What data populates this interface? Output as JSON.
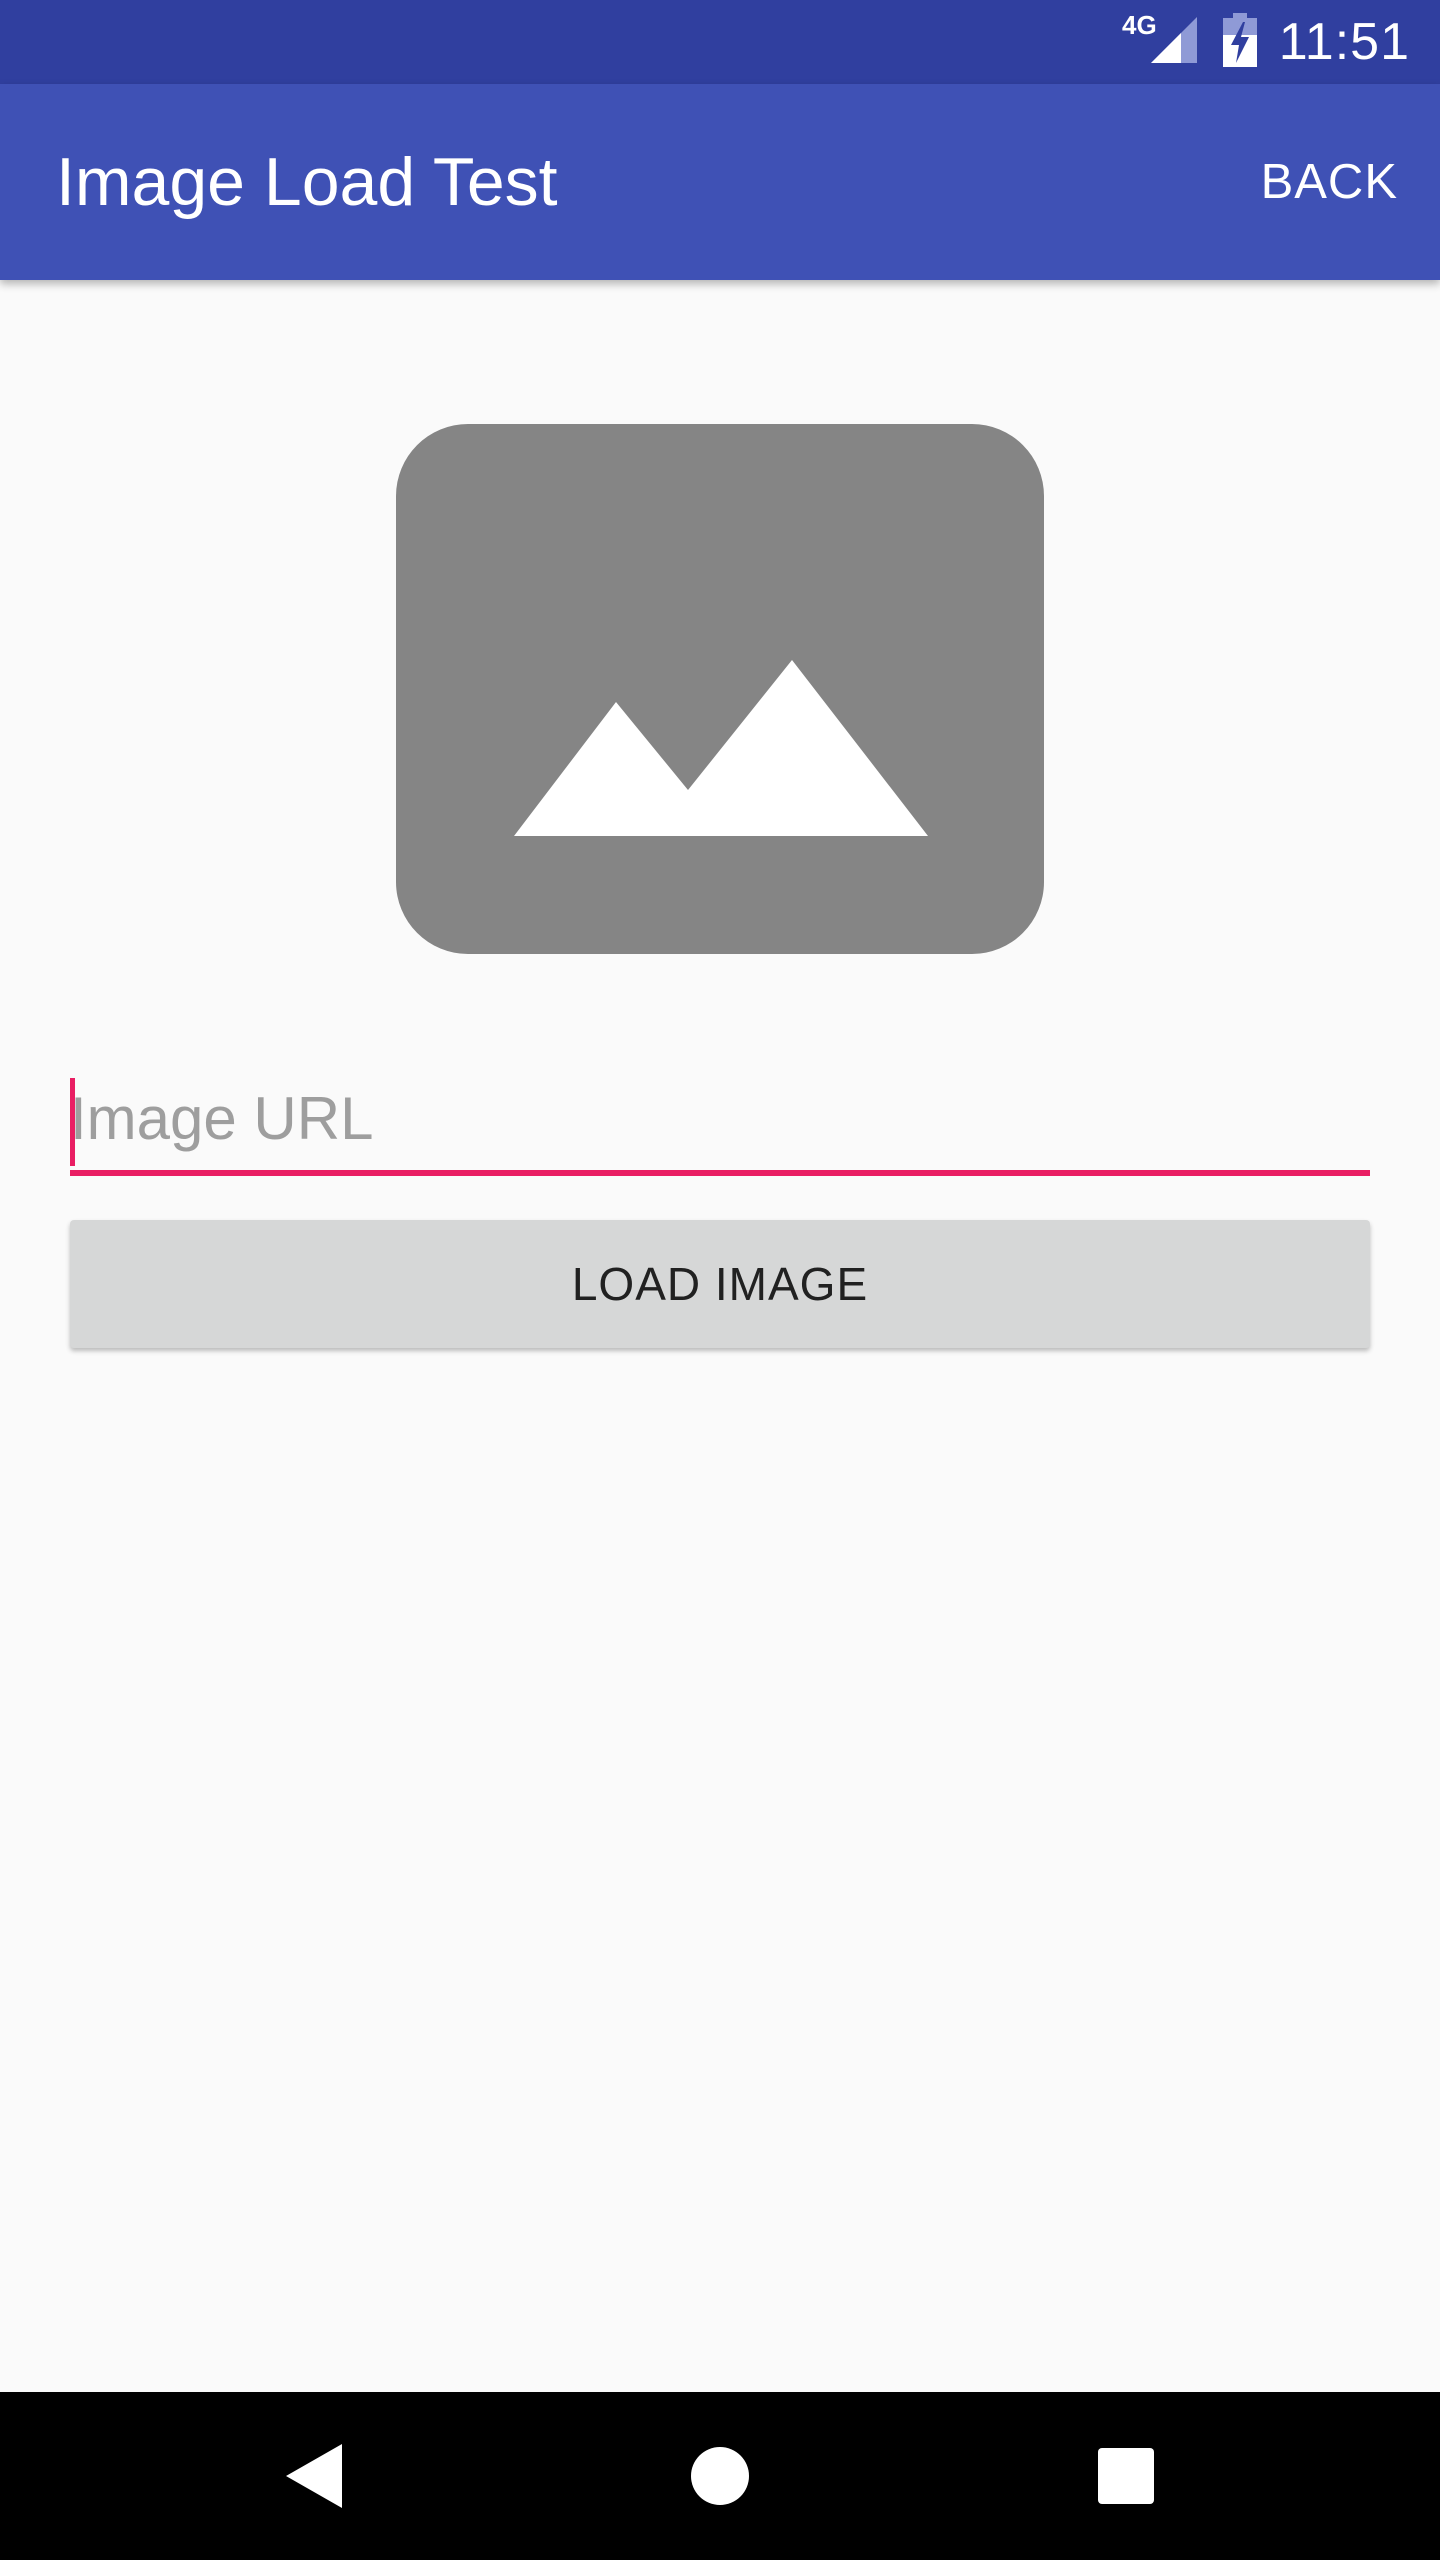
{
  "status_bar": {
    "network": "4G",
    "time": "11:51",
    "icons": [
      "signal-icon",
      "battery-charging-icon"
    ]
  },
  "app_bar": {
    "title": "Image Load Test",
    "back_label": "BACK"
  },
  "image": {
    "icon": "image-placeholder-icon"
  },
  "url_input": {
    "placeholder": "Image URL",
    "value": ""
  },
  "load_button": {
    "label": "LOAD IMAGE"
  },
  "nav_bar": {
    "icons": [
      "back-triangle-icon",
      "home-circle-icon",
      "recents-square-icon"
    ]
  },
  "colors": {
    "status_bar": "#303f9f",
    "primary": "#3f51b5",
    "accent": "#e91e63",
    "background": "#fafafa",
    "button": "#d6d7d7",
    "placeholder_gray": "#858585"
  }
}
